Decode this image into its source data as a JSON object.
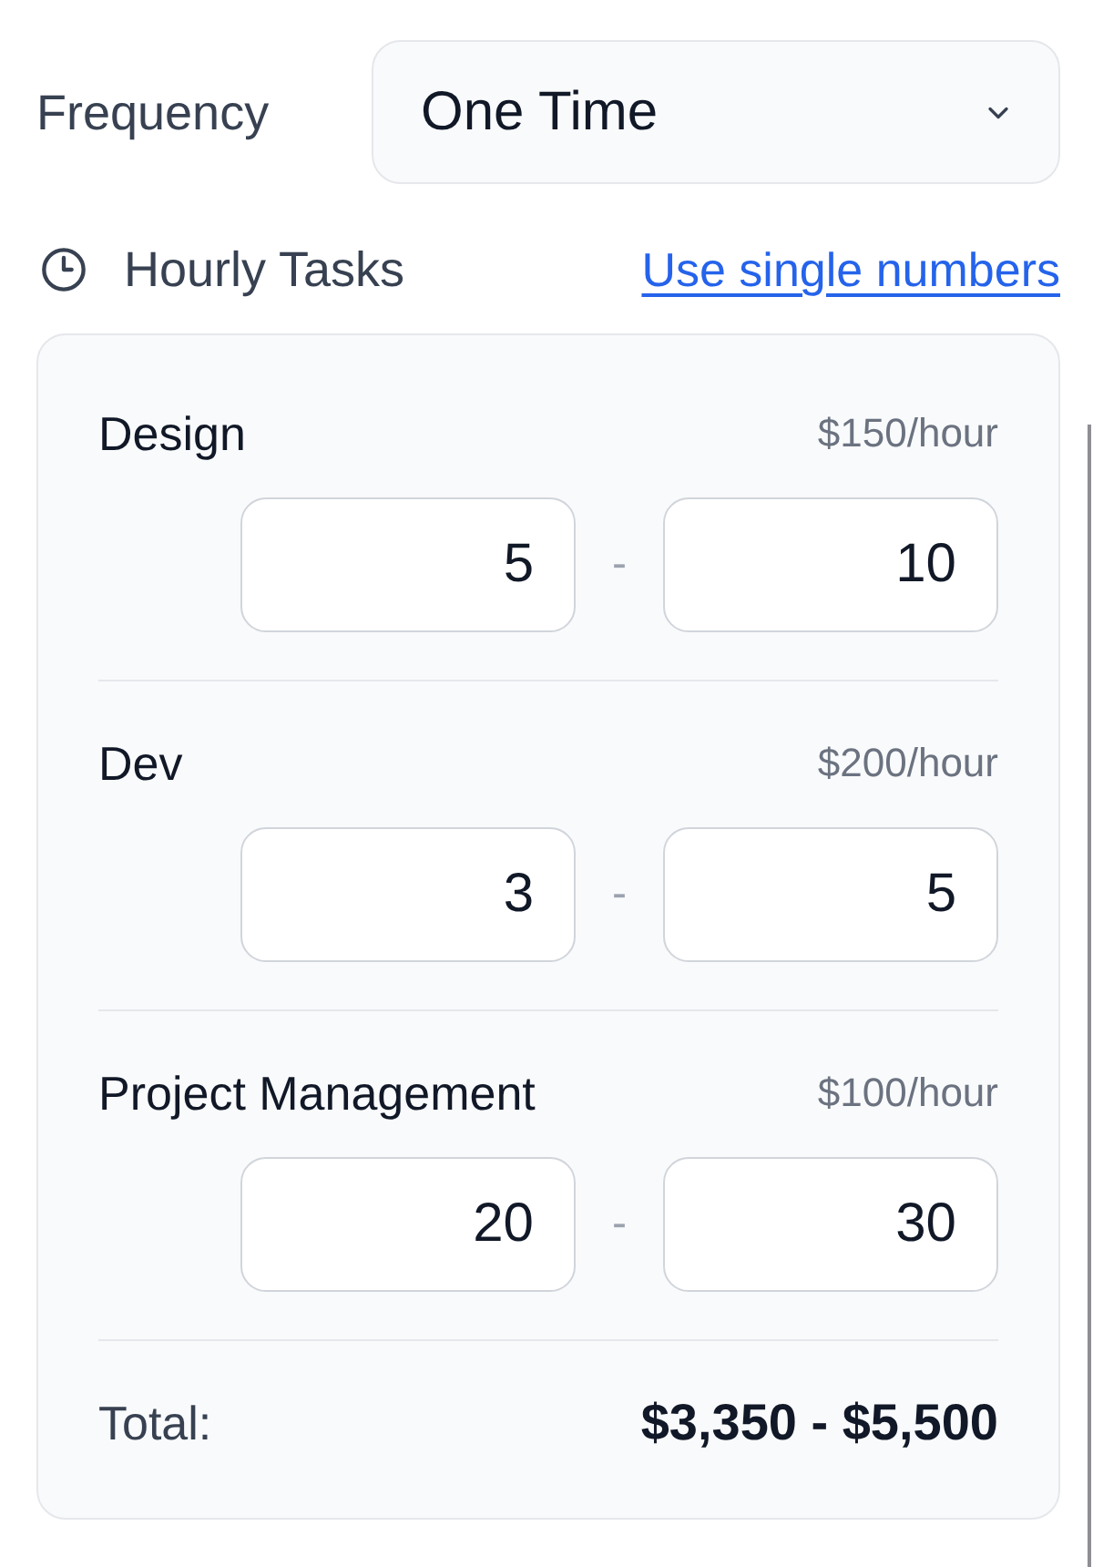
{
  "frequency": {
    "label": "Frequency",
    "value": "One Time"
  },
  "hourly_tasks": {
    "title": "Hourly Tasks",
    "link": "Use single numbers"
  },
  "tasks": [
    {
      "name": "Design",
      "rate": "$150/hour",
      "min": "5",
      "separator": "-",
      "max": "10"
    },
    {
      "name": "Dev",
      "rate": "$200/hour",
      "min": "3",
      "separator": "-",
      "max": "5"
    },
    {
      "name": "Project Management",
      "rate": "$100/hour",
      "min": "20",
      "separator": "-",
      "max": "30"
    }
  ],
  "total": {
    "label": "Total:",
    "value": "$3,350 - $5,500"
  }
}
